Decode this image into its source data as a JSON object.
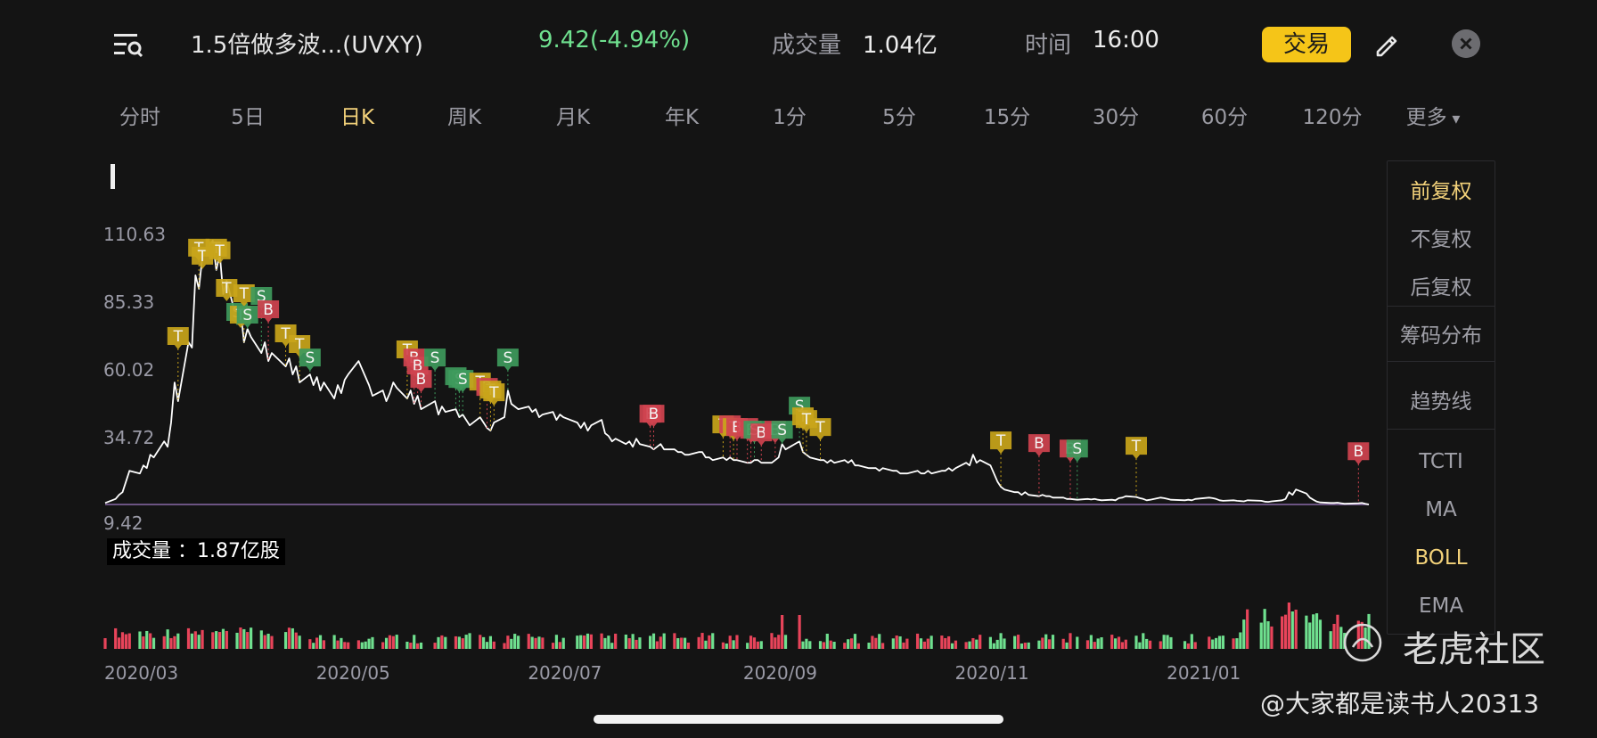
{
  "header": {
    "stock_name": "1.5倍做多波...(UVXY)",
    "price_change": "9.42(-4.94%)",
    "volume_label": "成交量",
    "volume_value": "1.04亿",
    "time_label": "时间",
    "time_value": "16:00",
    "trade_button": "交易"
  },
  "tabs": [
    "分时",
    "5日",
    "日K",
    "周K",
    "月K",
    "年K",
    "1分",
    "5分",
    "15分",
    "30分",
    "60分",
    "120分",
    "更多"
  ],
  "active_tab": "日K",
  "side_panel": {
    "items": [
      "前复权",
      "不复权",
      "后复权",
      "筹码分布",
      "趋势线",
      "TCTI",
      "MA",
      "BOLL",
      "EMA"
    ],
    "active": [
      "前复权",
      "BOLL"
    ]
  },
  "volume_tag": "成交量 ：1.87亿股",
  "watermark": {
    "brand": "老虎社区",
    "author": "@大家都是读书人20313"
  },
  "colors": {
    "accent": "#f5c518",
    "up": "#e8445a",
    "down": "#6fe08f",
    "line": "#ffffff",
    "active_tab": "#f3d27a"
  },
  "chart_data": {
    "type": "line",
    "y_ticks": [
      "110.63",
      "85.33",
      "60.02",
      "34.72",
      "9.42"
    ],
    "x_ticks": [
      "2020/03",
      "2020/05",
      "2020/07",
      "2020/09",
      "2020/11",
      "2021/01"
    ],
    "ylim": [
      9.42,
      110.63
    ],
    "price_series": [
      [
        "2020-02-21",
        10
      ],
      [
        "2020-02-24",
        11.5
      ],
      [
        "2020-02-25",
        13
      ],
      [
        "2020-02-26",
        14
      ],
      [
        "2020-02-27",
        18
      ],
      [
        "2020-02-28",
        22
      ],
      [
        "2020-03-02",
        21
      ],
      [
        "2020-03-03",
        24
      ],
      [
        "2020-03-04",
        23
      ],
      [
        "2020-03-05",
        28
      ],
      [
        "2020-03-06",
        27
      ],
      [
        "2020-03-09",
        33
      ],
      [
        "2020-03-10",
        31
      ],
      [
        "2020-03-11",
        40
      ],
      [
        "2020-03-12",
        55
      ],
      [
        "2020-03-13",
        48
      ],
      [
        "2020-03-16",
        70
      ],
      [
        "2020-03-17",
        68
      ],
      [
        "2020-03-18",
        95
      ],
      [
        "2020-03-19",
        90
      ],
      [
        "2020-03-20",
        102
      ],
      [
        "2020-03-23",
        108
      ],
      [
        "2020-03-24",
        97
      ],
      [
        "2020-03-25",
        103
      ],
      [
        "2020-03-26",
        88
      ],
      [
        "2020-03-27",
        93
      ],
      [
        "2020-03-30",
        78
      ],
      [
        "2020-03-31",
        82
      ],
      [
        "2020-04-01",
        70
      ],
      [
        "2020-04-02",
        75
      ],
      [
        "2020-04-03",
        72
      ],
      [
        "2020-04-06",
        66
      ],
      [
        "2020-04-07",
        70
      ],
      [
        "2020-04-08",
        63
      ],
      [
        "2020-04-09",
        66
      ],
      [
        "2020-04-13",
        61
      ],
      [
        "2020-04-14",
        64
      ],
      [
        "2020-04-15",
        58
      ],
      [
        "2020-04-16",
        61
      ],
      [
        "2020-04-17",
        55
      ],
      [
        "2020-04-20",
        58
      ],
      [
        "2020-04-21",
        54
      ],
      [
        "2020-04-22",
        57
      ],
      [
        "2020-04-23",
        52
      ],
      [
        "2020-04-24",
        55
      ],
      [
        "2020-04-27",
        49
      ],
      [
        "2020-04-28",
        54
      ],
      [
        "2020-04-29",
        51
      ],
      [
        "2020-04-30",
        56
      ],
      [
        "2020-05-01",
        58
      ],
      [
        "2020-05-04",
        63
      ],
      [
        "2020-05-05",
        60
      ],
      [
        "2020-05-06",
        57
      ],
      [
        "2020-05-07",
        54
      ],
      [
        "2020-05-08",
        50
      ],
      [
        "2020-05-11",
        52
      ],
      [
        "2020-05-12",
        48
      ],
      [
        "2020-05-13",
        51
      ],
      [
        "2020-05-14",
        55
      ],
      [
        "2020-05-15",
        53
      ],
      [
        "2020-05-18",
        49
      ],
      [
        "2020-05-19",
        52
      ],
      [
        "2020-05-20",
        47
      ],
      [
        "2020-05-21",
        50
      ],
      [
        "2020-05-22",
        45
      ],
      [
        "2020-05-26",
        48
      ],
      [
        "2020-05-27",
        43
      ],
      [
        "2020-05-28",
        46
      ],
      [
        "2020-05-29",
        44
      ],
      [
        "2020-06-01",
        45
      ],
      [
        "2020-06-02",
        42
      ],
      [
        "2020-06-03",
        43
      ],
      [
        "2020-06-04",
        41
      ],
      [
        "2020-06-05",
        39
      ],
      [
        "2020-06-08",
        42
      ],
      [
        "2020-06-09",
        40
      ],
      [
        "2020-06-10",
        38
      ],
      [
        "2020-06-11",
        37
      ],
      [
        "2020-06-12",
        40
      ],
      [
        "2020-06-15",
        42
      ],
      [
        "2020-06-16",
        52
      ],
      [
        "2020-06-17",
        47
      ],
      [
        "2020-06-18",
        46
      ],
      [
        "2020-06-19",
        45
      ],
      [
        "2020-06-22",
        46
      ],
      [
        "2020-06-23",
        44
      ],
      [
        "2020-06-24",
        45
      ],
      [
        "2020-06-25",
        42
      ],
      [
        "2020-06-26",
        43
      ],
      [
        "2020-06-29",
        44
      ],
      [
        "2020-06-30",
        41
      ],
      [
        "2020-07-01",
        43
      ],
      [
        "2020-07-02",
        42
      ],
      [
        "2020-07-06",
        40
      ],
      [
        "2020-07-07",
        38
      ],
      [
        "2020-07-08",
        40
      ],
      [
        "2020-07-09",
        37
      ],
      [
        "2020-07-10",
        39
      ],
      [
        "2020-07-13",
        41
      ],
      [
        "2020-07-14",
        36
      ],
      [
        "2020-07-15",
        35
      ],
      [
        "2020-07-16",
        33
      ],
      [
        "2020-07-17",
        34
      ],
      [
        "2020-07-20",
        32
      ],
      [
        "2020-07-21",
        33
      ],
      [
        "2020-07-22",
        31
      ],
      [
        "2020-07-23",
        34
      ],
      [
        "2020-07-24",
        32
      ],
      [
        "2020-07-27",
        31
      ],
      [
        "2020-07-28",
        30
      ],
      [
        "2020-07-29",
        31
      ],
      [
        "2020-07-30",
        32
      ],
      [
        "2020-07-31",
        30
      ],
      [
        "2020-08-03",
        30
      ],
      [
        "2020-08-04",
        29
      ],
      [
        "2020-08-05",
        29
      ],
      [
        "2020-08-06",
        28
      ],
      [
        "2020-08-07",
        28
      ],
      [
        "2020-08-10",
        29
      ],
      [
        "2020-08-11",
        29
      ],
      [
        "2020-08-12",
        27
      ],
      [
        "2020-08-13",
        27
      ],
      [
        "2020-08-14",
        26
      ],
      [
        "2020-08-17",
        27
      ],
      [
        "2020-08-18",
        26
      ],
      [
        "2020-08-19",
        27
      ],
      [
        "2020-08-20",
        26
      ],
      [
        "2020-08-21",
        26
      ],
      [
        "2020-08-24",
        25
      ],
      [
        "2020-08-25",
        25
      ],
      [
        "2020-08-26",
        26
      ],
      [
        "2020-08-27",
        26
      ],
      [
        "2020-08-28",
        25
      ],
      [
        "2020-08-31",
        25
      ],
      [
        "2020-09-01",
        26
      ],
      [
        "2020-09-02",
        27
      ],
      [
        "2020-09-03",
        32
      ],
      [
        "2020-09-04",
        30
      ],
      [
        "2020-09-08",
        33
      ],
      [
        "2020-09-09",
        29
      ],
      [
        "2020-09-10",
        28
      ],
      [
        "2020-09-11",
        27
      ],
      [
        "2020-09-14",
        26
      ],
      [
        "2020-09-15",
        26
      ],
      [
        "2020-09-16",
        25
      ],
      [
        "2020-09-17",
        26
      ],
      [
        "2020-09-18",
        25
      ],
      [
        "2020-09-21",
        26
      ],
      [
        "2020-09-22",
        25
      ],
      [
        "2020-09-23",
        26
      ],
      [
        "2020-09-24",
        24
      ],
      [
        "2020-09-25",
        24
      ],
      [
        "2020-09-28",
        23
      ],
      [
        "2020-09-29",
        23
      ],
      [
        "2020-09-30",
        23
      ],
      [
        "2020-10-01",
        22
      ],
      [
        "2020-10-02",
        23
      ],
      [
        "2020-10-05",
        22
      ],
      [
        "2020-10-06",
        22
      ],
      [
        "2020-10-07",
        21
      ],
      [
        "2020-10-08",
        21
      ],
      [
        "2020-10-09",
        21
      ],
      [
        "2020-10-12",
        22
      ],
      [
        "2020-10-13",
        21
      ],
      [
        "2020-10-14",
        21
      ],
      [
        "2020-10-15",
        22
      ],
      [
        "2020-10-16",
        21
      ],
      [
        "2020-10-19",
        22
      ],
      [
        "2020-10-20",
        22
      ],
      [
        "2020-10-21",
        23
      ],
      [
        "2020-10-22",
        22
      ],
      [
        "2020-10-23",
        23
      ],
      [
        "2020-10-26",
        25
      ],
      [
        "2020-10-27",
        24
      ],
      [
        "2020-10-28",
        28
      ],
      [
        "2020-10-29",
        25
      ],
      [
        "2020-10-30",
        26
      ],
      [
        "2020-11-02",
        24
      ],
      [
        "2020-11-03",
        21
      ],
      [
        "2020-11-04",
        18
      ],
      [
        "2020-11-05",
        16
      ],
      [
        "2020-11-06",
        15
      ],
      [
        "2020-11-09",
        14
      ],
      [
        "2020-11-10",
        14
      ],
      [
        "2020-11-11",
        13
      ],
      [
        "2020-11-12",
        14
      ],
      [
        "2020-11-13",
        13
      ],
      [
        "2020-11-16",
        12.5
      ],
      [
        "2020-11-17",
        13
      ],
      [
        "2020-11-18",
        12.5
      ],
      [
        "2020-11-19",
        12.5
      ],
      [
        "2020-11-20",
        12
      ],
      [
        "2020-11-23",
        12
      ],
      [
        "2020-11-24",
        11.5
      ],
      [
        "2020-11-25",
        11.5
      ],
      [
        "2020-11-27",
        11.2
      ],
      [
        "2020-11-30",
        11.5
      ],
      [
        "2020-12-01",
        11.3
      ],
      [
        "2020-12-02",
        11.5
      ],
      [
        "2020-12-03",
        11.2
      ],
      [
        "2020-12-04",
        11
      ],
      [
        "2020-12-07",
        11.2
      ],
      [
        "2020-12-08",
        11
      ],
      [
        "2020-12-09",
        11.8
      ],
      [
        "2020-12-10",
        12
      ],
      [
        "2020-12-11",
        12.5
      ],
      [
        "2020-12-14",
        12.2
      ],
      [
        "2020-12-15",
        11.8
      ],
      [
        "2020-12-16",
        11.5
      ],
      [
        "2020-12-17",
        11
      ],
      [
        "2020-12-18",
        11.2
      ],
      [
        "2020-12-21",
        12
      ],
      [
        "2020-12-22",
        11.8
      ],
      [
        "2020-12-23",
        11.5
      ],
      [
        "2020-12-24",
        11.2
      ],
      [
        "2020-12-28",
        11
      ],
      [
        "2020-12-29",
        11.2
      ],
      [
        "2020-12-30",
        11
      ],
      [
        "2020-12-31",
        11.5
      ],
      [
        "2021-01-04",
        12
      ],
      [
        "2021-01-05",
        11.8
      ],
      [
        "2021-01-06",
        11.5
      ],
      [
        "2021-01-07",
        11
      ],
      [
        "2021-01-08",
        10.8
      ],
      [
        "2021-01-11",
        11
      ],
      [
        "2021-01-12",
        10.8
      ],
      [
        "2021-01-13",
        10.7
      ],
      [
        "2021-01-14",
        10.6
      ],
      [
        "2021-01-15",
        11
      ],
      [
        "2021-01-19",
        10.8
      ],
      [
        "2021-01-20",
        10.5
      ],
      [
        "2021-01-21",
        10.4
      ],
      [
        "2021-01-22",
        10.6
      ],
      [
        "2021-01-25",
        11
      ],
      [
        "2021-01-26",
        11.5
      ],
      [
        "2021-01-27",
        14
      ],
      [
        "2021-01-28",
        13
      ],
      [
        "2021-01-29",
        15
      ],
      [
        "2021-02-01",
        13.5
      ],
      [
        "2021-02-02",
        12
      ],
      [
        "2021-02-03",
        11.2
      ],
      [
        "2021-02-04",
        10.5
      ],
      [
        "2021-02-05",
        10.2
      ],
      [
        "2021-02-08",
        10
      ],
      [
        "2021-02-09",
        10
      ],
      [
        "2021-02-10",
        10.1
      ],
      [
        "2021-02-11",
        9.9
      ],
      [
        "2021-02-12",
        9.7
      ],
      [
        "2021-02-16",
        9.9
      ],
      [
        "2021-02-17",
        10
      ],
      [
        "2021-02-18",
        9.7
      ],
      [
        "2021-02-19",
        9.42
      ]
    ],
    "trade_markers": [
      [
        "2020-03-13",
        "T",
        71
      ],
      [
        "2020-03-19",
        "T",
        104
      ],
      [
        "2020-03-20",
        "T",
        101
      ],
      [
        "2020-03-24",
        "T",
        104
      ],
      [
        "2020-03-25",
        "T",
        103
      ],
      [
        "2020-03-27",
        "T",
        89
      ],
      [
        "2020-03-30",
        "S",
        80
      ],
      [
        "2020-03-31",
        "T",
        79
      ],
      [
        "2020-04-01",
        "T",
        87
      ],
      [
        "2020-04-02",
        "S",
        79
      ],
      [
        "2020-04-06",
        "S",
        86
      ],
      [
        "2020-04-08",
        "B",
        81
      ],
      [
        "2020-04-13",
        "T",
        72
      ],
      [
        "2020-04-17",
        "T",
        68
      ],
      [
        "2020-04-20",
        "S",
        63
      ],
      [
        "2020-05-18",
        "T",
        66
      ],
      [
        "2020-05-20",
        "B",
        63
      ],
      [
        "2020-05-21",
        "B",
        60
      ],
      [
        "2020-05-22",
        "B",
        55
      ],
      [
        "2020-05-26",
        "S",
        63
      ],
      [
        "2020-06-01",
        "S",
        56
      ],
      [
        "2020-06-02",
        "S",
        55
      ],
      [
        "2020-06-03",
        "S",
        55
      ],
      [
        "2020-06-08",
        "T",
        54
      ],
      [
        "2020-06-10",
        "B",
        52
      ],
      [
        "2020-06-11",
        "T",
        51
      ],
      [
        "2020-06-12",
        "T",
        50
      ],
      [
        "2020-06-16",
        "S",
        63
      ],
      [
        "2020-07-27",
        "B",
        42
      ],
      [
        "2020-07-28",
        "B",
        42
      ],
      [
        "2020-08-17",
        "T",
        38
      ],
      [
        "2020-08-19",
        "B",
        38
      ],
      [
        "2020-08-20",
        "T",
        37
      ],
      [
        "2020-08-21",
        "B",
        37
      ],
      [
        "2020-08-24",
        "B",
        37
      ],
      [
        "2020-08-25",
        "B",
        36
      ],
      [
        "2020-08-26",
        "S",
        36
      ],
      [
        "2020-08-28",
        "B",
        35
      ],
      [
        "2020-09-01",
        "B",
        36
      ],
      [
        "2020-09-03",
        "S",
        36
      ],
      [
        "2020-09-08",
        "S",
        45
      ],
      [
        "2020-09-09",
        "T",
        41
      ],
      [
        "2020-09-10",
        "T",
        40
      ],
      [
        "2020-09-14",
        "T",
        37
      ],
      [
        "2020-11-05",
        "T",
        32
      ],
      [
        "2020-11-16",
        "B",
        31
      ],
      [
        "2020-11-25",
        "B",
        29
      ],
      [
        "2020-11-27",
        "S",
        29
      ],
      [
        "2020-12-14",
        "T",
        30
      ],
      [
        "2021-02-16",
        "B",
        28
      ]
    ],
    "volume_series_desc": "daily volume bars, red=up, green=down"
  }
}
